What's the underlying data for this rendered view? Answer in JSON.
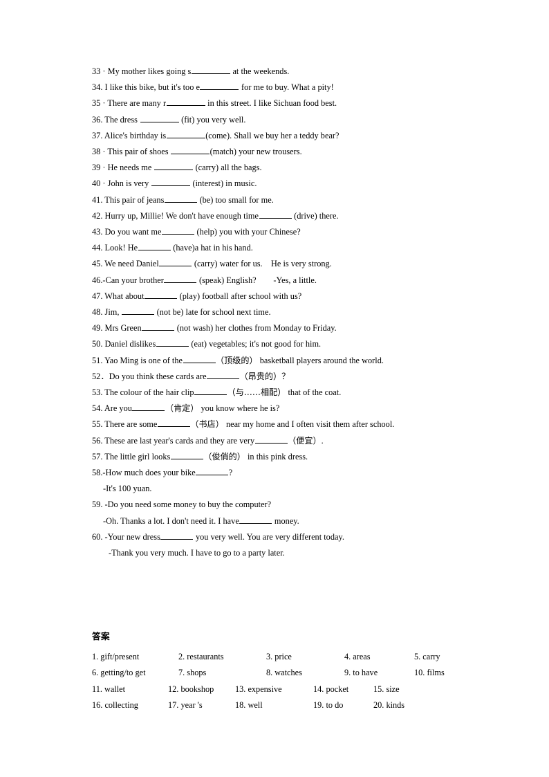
{
  "document": {
    "type": "english-grammar-worksheet",
    "answers_heading": "答案"
  },
  "exercises": [
    {
      "id": "q33",
      "pre": "33 · My mother likes going s",
      "blank": "w1",
      "post": " at the weekends."
    },
    {
      "id": "q34",
      "pre": "34. I like this bike, but it's too e",
      "blank": "w1",
      "post": " for me to buy. What a pity!"
    },
    {
      "id": "q35",
      "pre": "35 · There are many r",
      "blank": "w1",
      "post": " in this street. I like Sichuan food best."
    },
    {
      "id": "q36",
      "pre": "36. The dress ",
      "blank": "w1",
      "post": " (fit) you very well."
    },
    {
      "id": "q37",
      "pre": "37. Alice's birthday is",
      "blank": "w1",
      "post": "(come). Shall we buy her a teddy bear?"
    },
    {
      "id": "q38",
      "pre": "38 · This pair of shoes ",
      "blank": "w1",
      "post": "(match) your new trousers."
    },
    {
      "id": "q39",
      "pre": "39 · He needs me ",
      "blank": "w1",
      "post": " (carry) all the bags."
    },
    {
      "id": "q40",
      "pre": "40 · John is very ",
      "blank": "w1",
      "post": " (interest) in music."
    },
    {
      "id": "q41",
      "pre": "41. This pair of jeans",
      "blank": "w2",
      "post": " (be) too small for me."
    },
    {
      "id": "q42",
      "pre": "42. Hurry up, Millie! We don't have enough time",
      "blank": "w2",
      "post": " (drive) there."
    },
    {
      "id": "q43",
      "pre": "43. Do you want me",
      "blank": "w2",
      "post": " (help) you with your Chinese?"
    },
    {
      "id": "q44",
      "pre": "44. Look! He",
      "blank": "w2",
      "post": " (have)a hat in his hand."
    },
    {
      "id": "q45",
      "pre": "45. We need Daniel",
      "blank": "w2",
      "post": " (carry) water for us.    He is very strong."
    },
    {
      "id": "q46",
      "pre": "46.-Can your brother",
      "blank": "w2",
      "post": " (speak) English?        -Yes, a little."
    },
    {
      "id": "q47",
      "pre": "47. What about",
      "blank": "w2",
      "post": " (play) football after school with us?"
    },
    {
      "id": "q48",
      "pre": "48. Jim, ",
      "blank": "w2",
      "post": " (not be) late for school next time."
    },
    {
      "id": "q49",
      "pre": "49. Mrs Green",
      "blank": "w2",
      "post": " (not wash) her clothes from Monday to Friday."
    },
    {
      "id": "q50",
      "pre": "50. Daniel dislikes",
      "blank": "w2",
      "post": " (eat) vegetables; it's not good for him."
    },
    {
      "id": "q51",
      "pre": "51. Yao Ming is one of the",
      "blank": "w2",
      "cn": "（顶级的）",
      "post": " basketball players around the world."
    },
    {
      "id": "q52",
      "pre": "52．Do you think these cards are",
      "blank": "w2",
      "cn": "（昂贵的）",
      "post": "？"
    },
    {
      "id": "q53",
      "pre": "53. The colour of the hair clip",
      "blank": "w2",
      "cn": "（与……相配）",
      "post": " that of the coat."
    },
    {
      "id": "q54",
      "pre": "54. Are you",
      "blank": "w2",
      "cn": "（肯定）",
      "post": " you know where he is?"
    },
    {
      "id": "q55",
      "pre": "55. There are some",
      "blank": "w2",
      "cn": "（书店）",
      "post": " near my home and I often visit them after school."
    },
    {
      "id": "q56",
      "pre": "56. These are last year's cards and they are very",
      "blank": "w2",
      "cn": "（便宜）",
      "post": "."
    },
    {
      "id": "q57",
      "pre": "57. The little girl looks",
      "blank": "w2",
      "cn": "（俊俏的）",
      "post": " in this pink dress."
    },
    {
      "id": "q58",
      "pre": "58.-How much does your bike",
      "blank": "w2",
      "post": "?"
    },
    {
      "id": "q58b",
      "indent": "sub",
      "pre": "-It's 100 yuan.",
      "post": ""
    },
    {
      "id": "q59",
      "pre": "59. -Do you need some money to buy the computer?",
      "post": ""
    },
    {
      "id": "q59b",
      "indent": "sub",
      "pre": "-Oh. Thanks a lot. I don't need it. I have",
      "blank": "w2",
      "post": " money."
    },
    {
      "id": "q60",
      "pre": "60. -Your new dress",
      "blank": "w2",
      "post": " you very well. You are very different today."
    },
    {
      "id": "q60b",
      "indent": "sub-deep",
      "pre": "-Thank you very much. I have to go to a party later.",
      "post": ""
    }
  ],
  "answer_rows": [
    {
      "spacing": "wide",
      "cells": [
        "1. gift/present",
        "2. restaurants",
        "3. price",
        "4. areas",
        "5. carry"
      ]
    },
    {
      "spacing": "wide",
      "cells": [
        "6. getting/to get",
        "7. shops",
        "8. watches",
        "9. to have",
        "10. films"
      ]
    },
    {
      "spacing": "narrow",
      "cells": [
        "11. wallet",
        "12. bookshop",
        "13. expensive",
        "14. pocket",
        "15. size"
      ]
    },
    {
      "spacing": "narrow",
      "cells": [
        "16. collecting",
        "17. year 's",
        "18. well",
        "19. to do",
        "20. kinds"
      ]
    }
  ]
}
